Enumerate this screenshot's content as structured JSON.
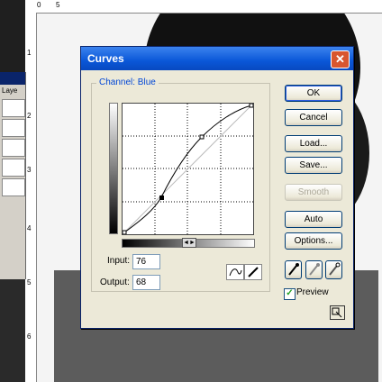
{
  "dialog": {
    "title": "Curves",
    "channel_label": "Channel: Blue",
    "input_label": "Input:",
    "input_value": "76",
    "output_label": "Output:",
    "output_value": "68",
    "buttons": {
      "ok": "OK",
      "cancel": "Cancel",
      "load": "Load...",
      "save": "Save...",
      "smooth": "Smooth",
      "auto": "Auto",
      "options": "Options..."
    },
    "preview_label": "Preview",
    "preview_checked": true,
    "close_glyph": "✕"
  },
  "background": {
    "layers_tab_label": "Laye",
    "ruler_top_labels": [
      "0",
      "5"
    ],
    "ruler_left_labels": [
      "1",
      "2",
      "3",
      "4",
      "5",
      "6"
    ]
  },
  "icons": {
    "curve_tool": "curve-icon",
    "pencil_tool": "pencil-icon",
    "black_eyedropper": "eyedropper-black-icon",
    "gray_eyedropper": "eyedropper-gray-icon",
    "white_eyedropper": "eyedropper-white-icon",
    "resize": "expand-icon"
  },
  "colors": {
    "title_bar": "#0a57d8",
    "dialog_bg": "#ece9d8",
    "channel_label": "#0046d5"
  }
}
